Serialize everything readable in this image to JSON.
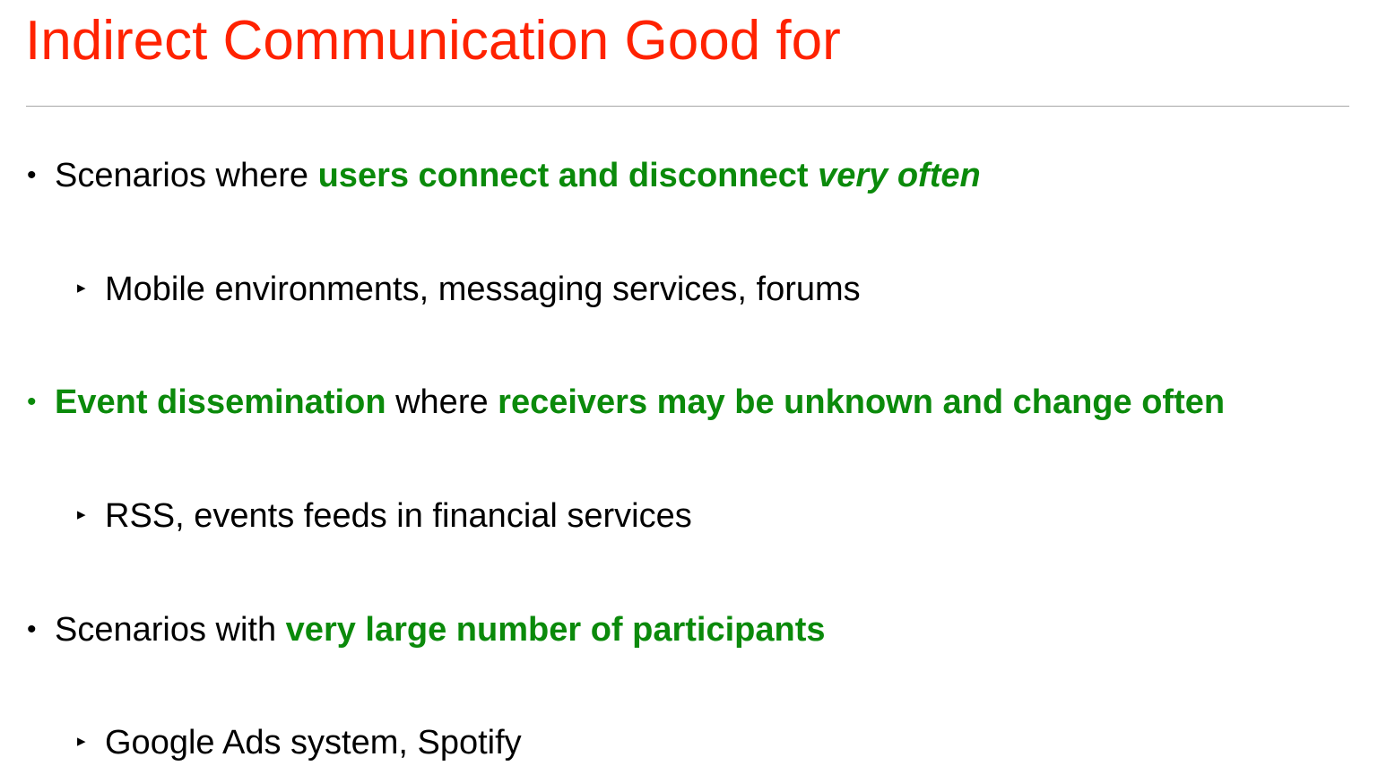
{
  "slide": {
    "title": "Indirect Communication Good for",
    "colors": {
      "title": "#ff2200",
      "emphasis": "#0b8a0b",
      "text": "#000000",
      "rule": "#a6a6a6"
    }
  },
  "bullets": [
    {
      "marker": "•",
      "marker_color": "#000000",
      "parts": [
        "Scenarios where ",
        "users connect and disconnect ",
        "very often"
      ],
      "sub": {
        "marker": "▸",
        "text": "Mobile environments, messaging services, forums"
      }
    },
    {
      "marker": "•",
      "marker_color": "#0b8a0b",
      "parts": [
        "Event dissemination",
        " where ",
        "receivers may be unknown and change often"
      ],
      "sub": {
        "marker": "▸",
        "text": "RSS, events feeds in financial services"
      }
    },
    {
      "marker": "•",
      "marker_color": "#000000",
      "parts": [
        "Scenarios with ",
        "very large number of participants"
      ],
      "sub": {
        "marker": "▸",
        "text": "Google Ads system, Spotify"
      }
    }
  ]
}
